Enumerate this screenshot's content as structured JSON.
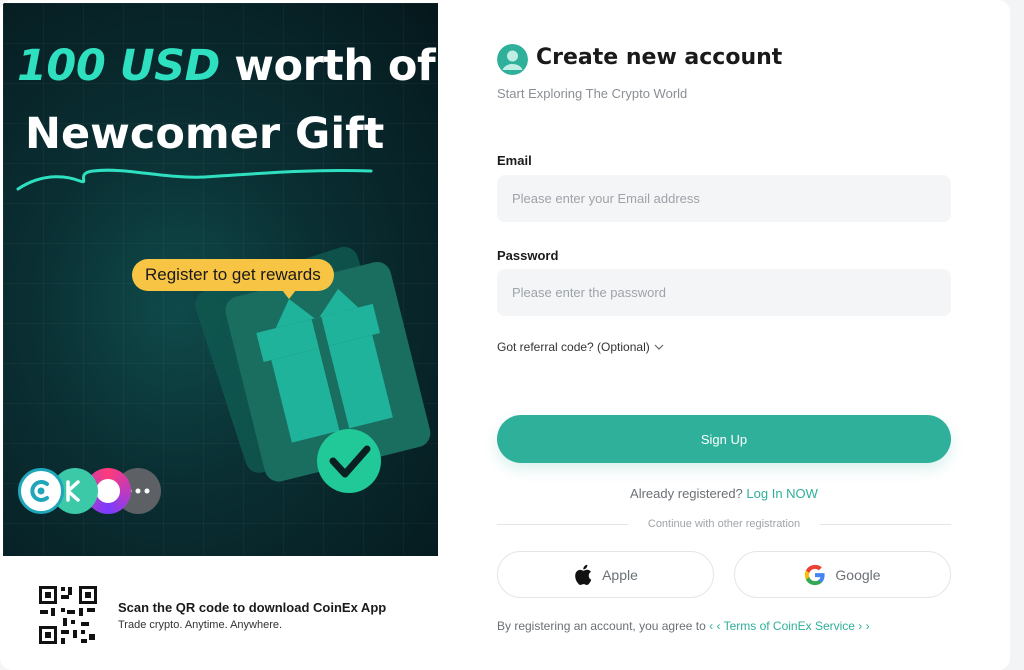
{
  "promo": {
    "headline_accent": "100 USD",
    "headline_rest": "worth of",
    "headline_line2": "Newcomer Gift",
    "reward_bubble": "Register to get rewards"
  },
  "qr": {
    "title": "Scan the QR code to download CoinEx App",
    "subtitle": "Trade crypto. Anytime. Anywhere."
  },
  "form": {
    "title": "Create new account",
    "subtitle": "Start Exploring The Crypto World",
    "email_label": "Email",
    "email_placeholder": "Please enter your Email address",
    "password_label": "Password",
    "password_placeholder": "Please enter the password",
    "referral": "Got referral code? (Optional)",
    "signup": "Sign Up",
    "already_text": "Already registered?",
    "login_link": "Log In NOW",
    "divider_text": "Continue with other registration",
    "apple": "Apple",
    "google": "Google",
    "terms_text": "By registering an account, you agree to",
    "terms_link": "‹ ‹ Terms of CoinEx Service › ›"
  },
  "colors": {
    "accent": "#2eb09a",
    "promo_bg": "#0a2f33",
    "headline_accent": "#2fe0c0",
    "bubble": "#f7c443"
  },
  "icons": [
    "brand-avatar-icon",
    "chevron-down-icon",
    "apple-icon",
    "google-icon",
    "qr-code-icon",
    "gift-icon",
    "checkmark-icon",
    "coinex-app-icon",
    "more-icon"
  ]
}
